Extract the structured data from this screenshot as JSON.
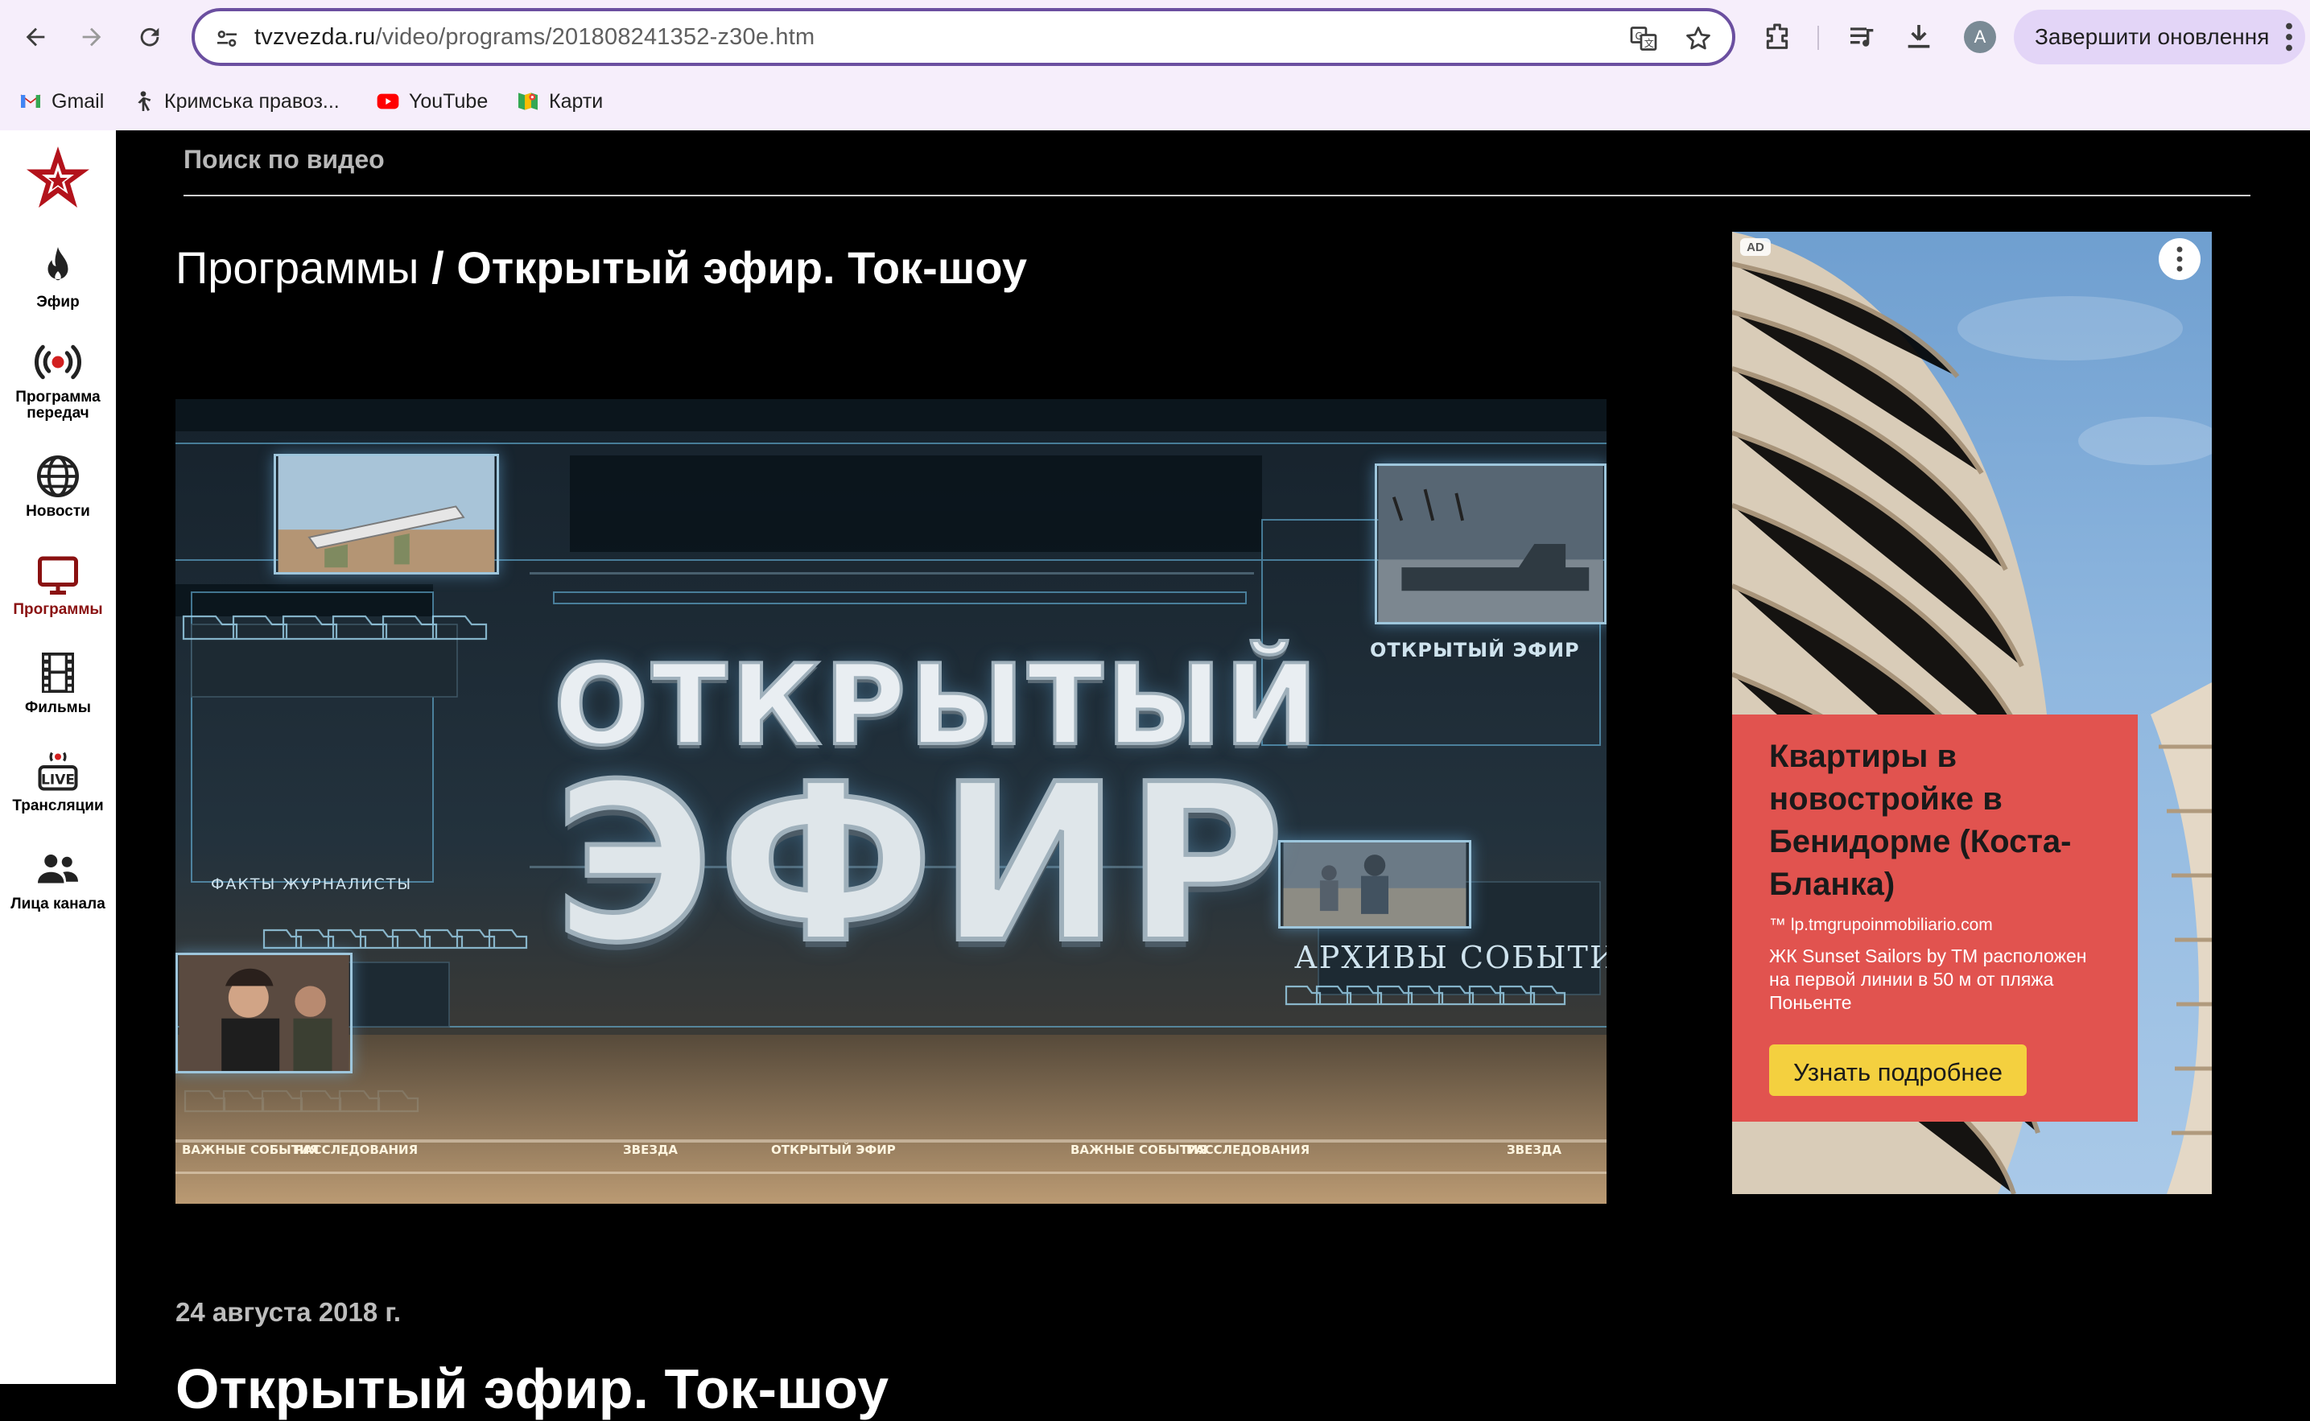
{
  "browser": {
    "url_domain": "tvzvezda.ru",
    "url_path": "/video/programs/201808241352-z30e.htm",
    "avatar_letter": "A",
    "update_label": "Завершити оновлення",
    "bookmarks": [
      {
        "label": "Gmail",
        "icon": "gmail-icon"
      },
      {
        "label": "Кримська правоз...",
        "icon": "person-icon"
      },
      {
        "label": "YouTube",
        "icon": "youtube-icon"
      },
      {
        "label": "Карти",
        "icon": "maps-icon"
      }
    ]
  },
  "sidebar": {
    "logo": "zvezda-star-logo",
    "items": [
      {
        "label": "Эфир",
        "icon": "flame-icon"
      },
      {
        "label": "Программа передач",
        "icon": "broadcast-icon"
      },
      {
        "label": "Новости",
        "icon": "globe-icon"
      },
      {
        "label": "Программы",
        "icon": "tv-icon",
        "active": true
      },
      {
        "label": "Фильмы",
        "icon": "film-icon"
      },
      {
        "label": "Трансляции",
        "icon": "live-icon"
      },
      {
        "label": "Лица канала",
        "icon": "people-icon"
      }
    ],
    "active_color": "#8a1111"
  },
  "page": {
    "search_label": "Поиск по видео",
    "breadcrumb_root": "Программы",
    "breadcrumb_sep": "/",
    "breadcrumb_current": "Открытый эфир. Ток-шоу",
    "hero": {
      "title_line1": "ОТКРЫТЫЙ",
      "title_line2": "ЭФИР",
      "tag_small": "ОТКРЫТЫЙ ЭФИР",
      "tag_left": "ФАКТЫ  ЖУРНАЛИСТЫ",
      "tag_archives": "АРХИВЫ   СОБЫТИЯ",
      "ticker": [
        "ВАЖНЫЕ СОБЫТИЯ",
        "РАССЛЕДОВАНИЯ",
        "ЗВЕЗДА",
        "ОТКРЫТЫЙ ЭФИР",
        "ВАЖНЫЕ СОБЫТИЯ",
        "РАССЛЕДОВАНИЯ",
        "ЗВЕЗДА"
      ]
    },
    "date": "24 августа 2018 г.",
    "title": "Открытый эфир. Ток-шоу"
  },
  "ad": {
    "badge": "AD",
    "headline": "Квартиры в новостройке в Бенидорме (Коста-Бланка)",
    "domain": "™ lp.tmgrupoinmobiliario.com",
    "description": "ЖК Sunset Sailors by TM расположен на первой линии в 50 м от пляжа Поньенте",
    "cta": "Узнать подробнее",
    "panel_color": "#e1534f",
    "cta_color": "#f4d03f"
  }
}
